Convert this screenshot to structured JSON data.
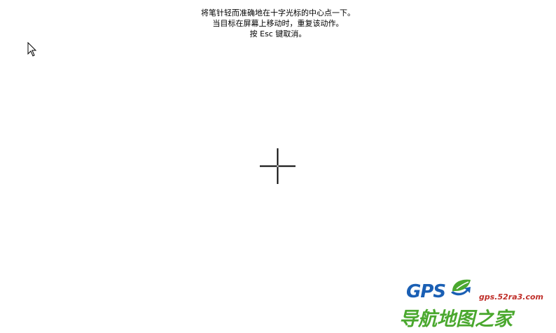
{
  "instructions": {
    "line1": "将笔针轻而准确地在十字光标的中心点一下。",
    "line2": "当目标在屏幕上移动时，重复该动作。",
    "line3": "按 Esc 键取消。"
  },
  "icons": {
    "pointer": "arrow-cursor-icon",
    "target": "crosshair-target-icon",
    "logo_leaf": "leaf-arrow-icon"
  },
  "watermark": {
    "logo_text": "GPS",
    "url": "gps.52ra3.com",
    "brand": "导航地图之家"
  },
  "colors": {
    "background": "#ffffff",
    "text": "#000000",
    "logo_blue": "#1a5fb4",
    "logo_green": "#4aa82e",
    "url_red": "#c0302b"
  }
}
